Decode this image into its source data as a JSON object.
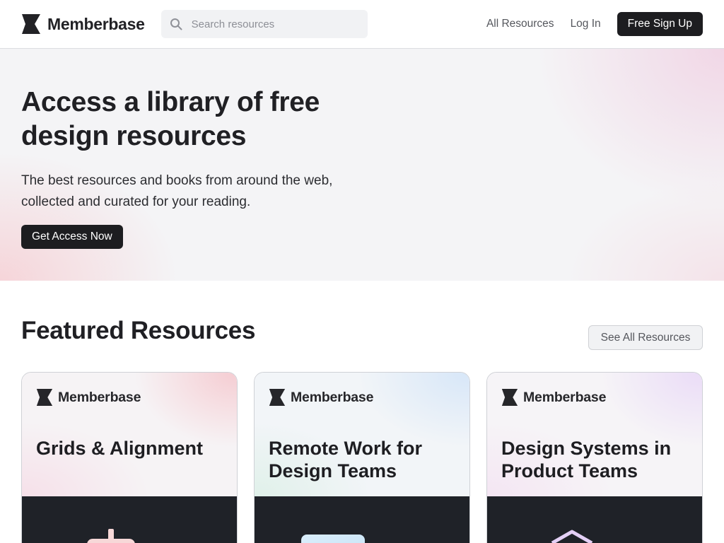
{
  "header": {
    "brand": "Memberbase",
    "search_placeholder": "Search resources",
    "nav_all": "All Resources",
    "nav_login": "Log In",
    "signup_label": "Free Sign Up"
  },
  "hero": {
    "title": "Access a library of free design resources",
    "subtitle": "The best resources and books from around the web, collected and curated for your reading.",
    "cta_label": "Get Access Now"
  },
  "featured": {
    "title": "Featured Resources",
    "see_all_label": "See All Resources",
    "cards": [
      {
        "brand": "Memberbase",
        "title": "Grids & Alignment"
      },
      {
        "brand": "Memberbase",
        "title": "Remote Work for Design Teams"
      },
      {
        "brand": "Memberbase",
        "title": "Design Systems in Product Teams"
      }
    ]
  },
  "colors": {
    "dark_button": "#1d1d20",
    "card_bottom": "#1f2228",
    "accent_pink": "#f5c9cf",
    "accent_blue": "#d8e6f7",
    "accent_purple": "#eadbf7"
  }
}
